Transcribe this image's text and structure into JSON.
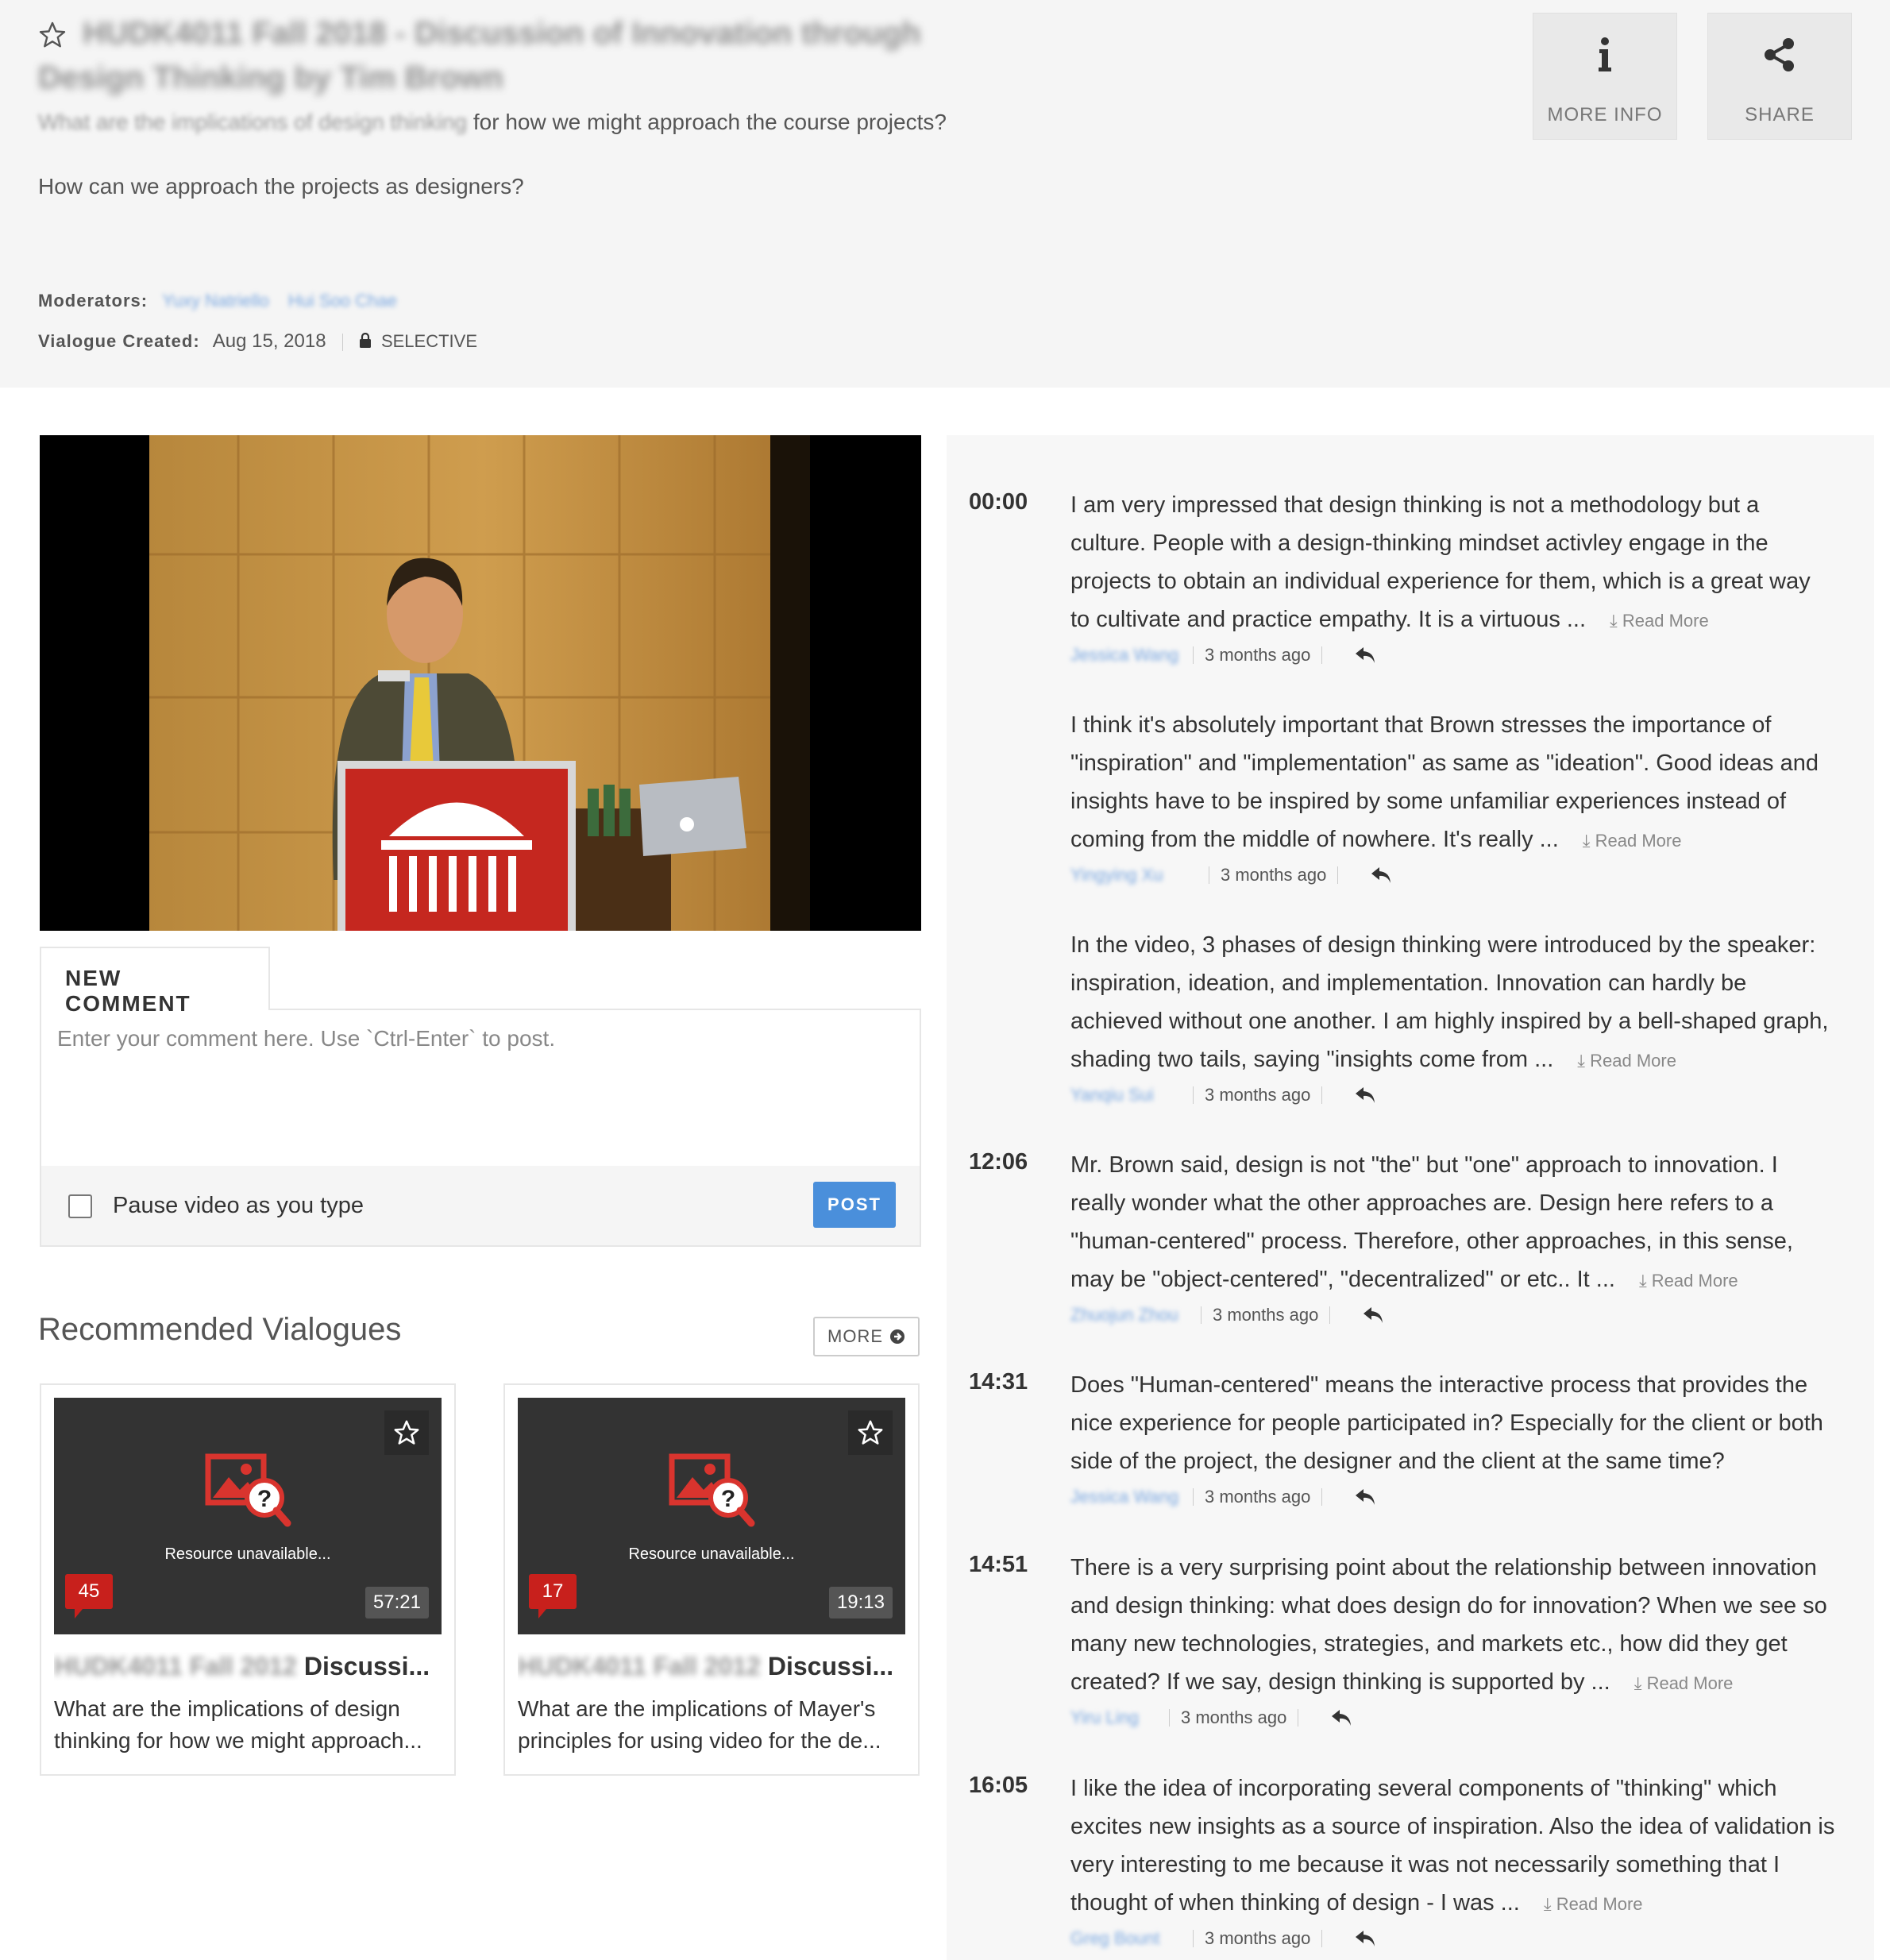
{
  "header": {
    "title": "HUDK4011 Fall 2018 - Discussion of Innovation through Design Thinking by Tim Brown",
    "question1_blur": "What are the implications of design thinking",
    "question1_rest": " for how we might approach the course projects?",
    "question2": "How can we approach the projects as designers?",
    "moderators_label": "Moderators:",
    "moderator1": "Yuxy Natriello",
    "moderator2": "Hui Soo Chae",
    "created_label": "Vialogue Created:",
    "created_date": "Aug 15, 2018",
    "privacy": "SELECTIVE",
    "more_info": "MORE INFO",
    "share": "SHARE"
  },
  "comment_form": {
    "tab_label": "NEW COMMENT",
    "placeholder": "Enter your comment here. Use `Ctrl-Enter` to post.",
    "pause_label": "Pause video as you type",
    "post_label": "POST"
  },
  "recommended": {
    "heading": "Recommended Vialogues",
    "more_label": "MORE",
    "cards": [
      {
        "title_blur": "HUDK4011 Fall 2012 ",
        "title": "Discussi...",
        "desc1": "What are the implications of design",
        "desc2": "thinking for how we might approach...",
        "unavailable": "Resource unavailable...",
        "count": "45",
        "duration": "57:21"
      },
      {
        "title_blur": "HUDK4011 Fall 2012 ",
        "title": "Discussi...",
        "desc1": "What are the implications of Mayer's",
        "desc2": "principles for using video for the de...",
        "unavailable": "Resource unavailable...",
        "count": "17",
        "duration": "19:13"
      }
    ]
  },
  "comments": [
    {
      "time": "00:00",
      "author": "Jessica Wang",
      "ago": "3 months ago",
      "read_more": "Read More",
      "lines": [
        "I am very impressed that design thinking is not a methodology but a",
        "culture. People with a design-thinking mindset activley engage in the",
        "projects to obtain an individual experience for them, which is a great way",
        "to cultivate and practice empathy. It is a virtuous ..."
      ]
    },
    {
      "time": "",
      "author": "Yingying Xu",
      "ago": "3 months ago",
      "read_more": "Read More",
      "lines": [
        "I think it's absolutely important that Brown stresses the importance of",
        "\"inspiration\" and \"implementation\" as same as \"ideation\". Good ideas and",
        "insights have to be inspired by some unfamiliar experiences instead of",
        "coming from the middle of nowhere. It's really ..."
      ]
    },
    {
      "time": "",
      "author": "Yanqiu Sui",
      "ago": "3 months ago",
      "read_more": "Read More",
      "lines": [
        "In the video, 3 phases of design thinking were introduced by the speaker:",
        "inspiration, ideation, and implementation. Innovation can hardly be",
        "achieved without one another. I am highly inspired by a bell-shaped graph,",
        "shading two tails, saying \"insights come from ..."
      ]
    },
    {
      "time": "12:06",
      "author": "Zhuojun Zhou",
      "ago": "3 months ago",
      "read_more": "Read More",
      "lines": [
        "Mr. Brown said, design is not \"the\" but \"one\" approach to innovation. I",
        "really wonder what the other approaches are. Design here refers to a",
        "\"human-centered\" process. Therefore, other approaches, in this sense,",
        "may be \"object-centered\", \"decentralized\" or etc.. It ..."
      ]
    },
    {
      "time": "14:31",
      "author": "Jessica Wang",
      "ago": "3 months ago",
      "read_more": "",
      "lines": [
        "Does \"Human-centered\" means the interactive process that provides the",
        "nice experience for people participated in? Especially for the client or both",
        "side of the project, the designer and the client at the same time?"
      ]
    },
    {
      "time": "14:51",
      "author": "Yiru Ling",
      "ago": "3 months ago",
      "read_more": "Read More",
      "lines": [
        "There is a very surprising point about the relationship between innovation",
        "and design thinking: what does design do for innovation? When we see so",
        "many new technologies, strategies, and markets etc., how did they get",
        "created? If we say, design thinking is supported by ..."
      ]
    },
    {
      "time": "16:05",
      "author": "Greg Bount",
      "ago": "3 months ago",
      "read_more": "Read More",
      "lines": [
        "I like the idea of incorporating several components of \"thinking\" which",
        "excites new insights as a source of inspiration. Also the idea of validation is",
        "very interesting to me because it was not necessarily something that I",
        "thought of when thinking of design - I was ..."
      ]
    }
  ]
}
